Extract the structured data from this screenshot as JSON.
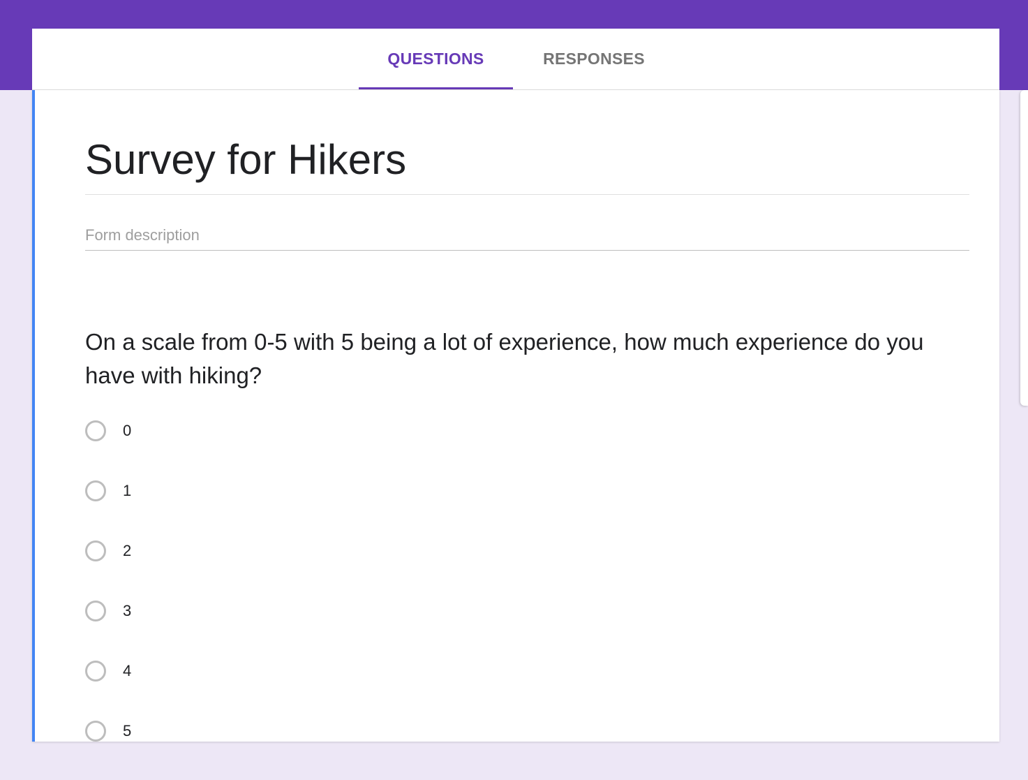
{
  "theme": {
    "accent": "#673ab7",
    "background": "#ede7f6",
    "card_accent": "#4285f4",
    "inactive_tab": "#757575"
  },
  "tabs": [
    {
      "label": "QUESTIONS",
      "active": true
    },
    {
      "label": "RESPONSES",
      "active": false
    }
  ],
  "form": {
    "title": "Survey for Hikers",
    "description_placeholder": "Form description"
  },
  "question": {
    "title": "On a scale from 0-5 with 5 being a lot of experience, how much experience do you have with hiking?",
    "type": "multiple-choice",
    "options": [
      {
        "label": "0"
      },
      {
        "label": "1"
      },
      {
        "label": "2"
      },
      {
        "label": "3"
      },
      {
        "label": "4"
      },
      {
        "label": "5"
      }
    ]
  }
}
